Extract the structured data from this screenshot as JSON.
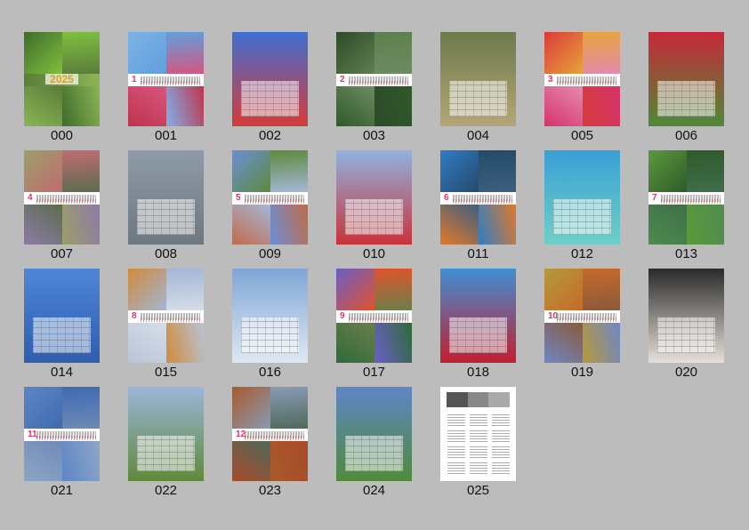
{
  "thumbnails": [
    {
      "label": "000",
      "kind": "cover",
      "year_text": "2025",
      "colors": [
        "#3f6b2a",
        "#7fbf3f",
        "#5a7d3a",
        "#8bb554"
      ]
    },
    {
      "label": "001",
      "kind": "strip",
      "month": "1",
      "colors": [
        "#7fb2e6",
        "#5fa0dd",
        "#d6567e",
        "#c0334e"
      ]
    },
    {
      "label": "002",
      "kind": "full",
      "colors": [
        "#3f6fd1",
        "#d63a3a"
      ]
    },
    {
      "label": "003",
      "kind": "strip",
      "month": "2",
      "colors": [
        "#2f4a2a",
        "#5d7f4e",
        "#6e8a62",
        "#2d5a2a"
      ]
    },
    {
      "label": "004",
      "kind": "full",
      "colors": [
        "#6c7a4c",
        "#b5a676"
      ]
    },
    {
      "label": "005",
      "kind": "strip",
      "month": "3",
      "colors": [
        "#d93b3b",
        "#e8a33a",
        "#e58ab0",
        "#d6336b"
      ]
    },
    {
      "label": "006",
      "kind": "full",
      "colors": [
        "#c8283a",
        "#4f8a35"
      ]
    },
    {
      "label": "007",
      "kind": "strip",
      "month": "4",
      "colors": [
        "#9aa066",
        "#c26b72",
        "#5a6d4f",
        "#8e7aa6"
      ]
    },
    {
      "label": "008",
      "kind": "full",
      "colors": [
        "#8e9aa6",
        "#6d7880"
      ]
    },
    {
      "label": "009",
      "kind": "strip",
      "month": "5",
      "colors": [
        "#6a8fd6",
        "#5d8a3a",
        "#a6b7da",
        "#c06b48"
      ]
    },
    {
      "label": "010",
      "kind": "full",
      "colors": [
        "#8fb3df",
        "#c8333a"
      ]
    },
    {
      "label": "011",
      "kind": "strip",
      "month": "6",
      "colors": [
        "#2f7cc6",
        "#244a6a",
        "#3d5f7e",
        "#e07a2a"
      ]
    },
    {
      "label": "012",
      "kind": "full",
      "colors": [
        "#3aa0d6",
        "#6fcfc6"
      ]
    },
    {
      "label": "013",
      "kind": "strip",
      "month": "7",
      "colors": [
        "#5c9a3c",
        "#2f5a2a",
        "#3f6e4a",
        "#4d8c4e"
      ]
    },
    {
      "label": "014",
      "kind": "full",
      "colors": [
        "#4e86d6",
        "#2f5db0"
      ]
    },
    {
      "label": "015",
      "kind": "strip",
      "month": "8",
      "colors": [
        "#d08a3a",
        "#a2b6d6",
        "#d6dde8",
        "#b8c4d6"
      ]
    },
    {
      "label": "016",
      "kind": "full",
      "colors": [
        "#7fa7d6",
        "#dfe8f2"
      ]
    },
    {
      "label": "017",
      "kind": "strip",
      "month": "9",
      "colors": [
        "#6a5fc6",
        "#e0532a",
        "#6a7f4a",
        "#2f6a3a"
      ]
    },
    {
      "label": "018",
      "kind": "full",
      "colors": [
        "#3f8fd6",
        "#c21e2e"
      ]
    },
    {
      "label": "019",
      "kind": "strip",
      "month": "10",
      "colors": [
        "#b59a3a",
        "#c66a2a",
        "#8a5a3a",
        "#6f86c6"
      ]
    },
    {
      "label": "020",
      "kind": "full",
      "colors": [
        "#2a2a2a",
        "#e8e0d8"
      ]
    },
    {
      "label": "021",
      "kind": "strip",
      "month": "11",
      "colors": [
        "#5c86c6",
        "#3f6ab0",
        "#6e8ab6",
        "#8ea6c6"
      ]
    },
    {
      "label": "022",
      "kind": "full",
      "colors": [
        "#9ab6da",
        "#5f8a3a"
      ]
    },
    {
      "label": "023",
      "kind": "strip",
      "month": "12",
      "colors": [
        "#a85a2a",
        "#8a9ab6",
        "#4f6a5a",
        "#a84a2a"
      ]
    },
    {
      "label": "024",
      "kind": "full",
      "colors": [
        "#5f86c6",
        "#4f8a3a"
      ]
    },
    {
      "label": "025",
      "kind": "overview",
      "colors": [
        "#555555",
        "#888888",
        "#aaaaaa"
      ]
    }
  ]
}
